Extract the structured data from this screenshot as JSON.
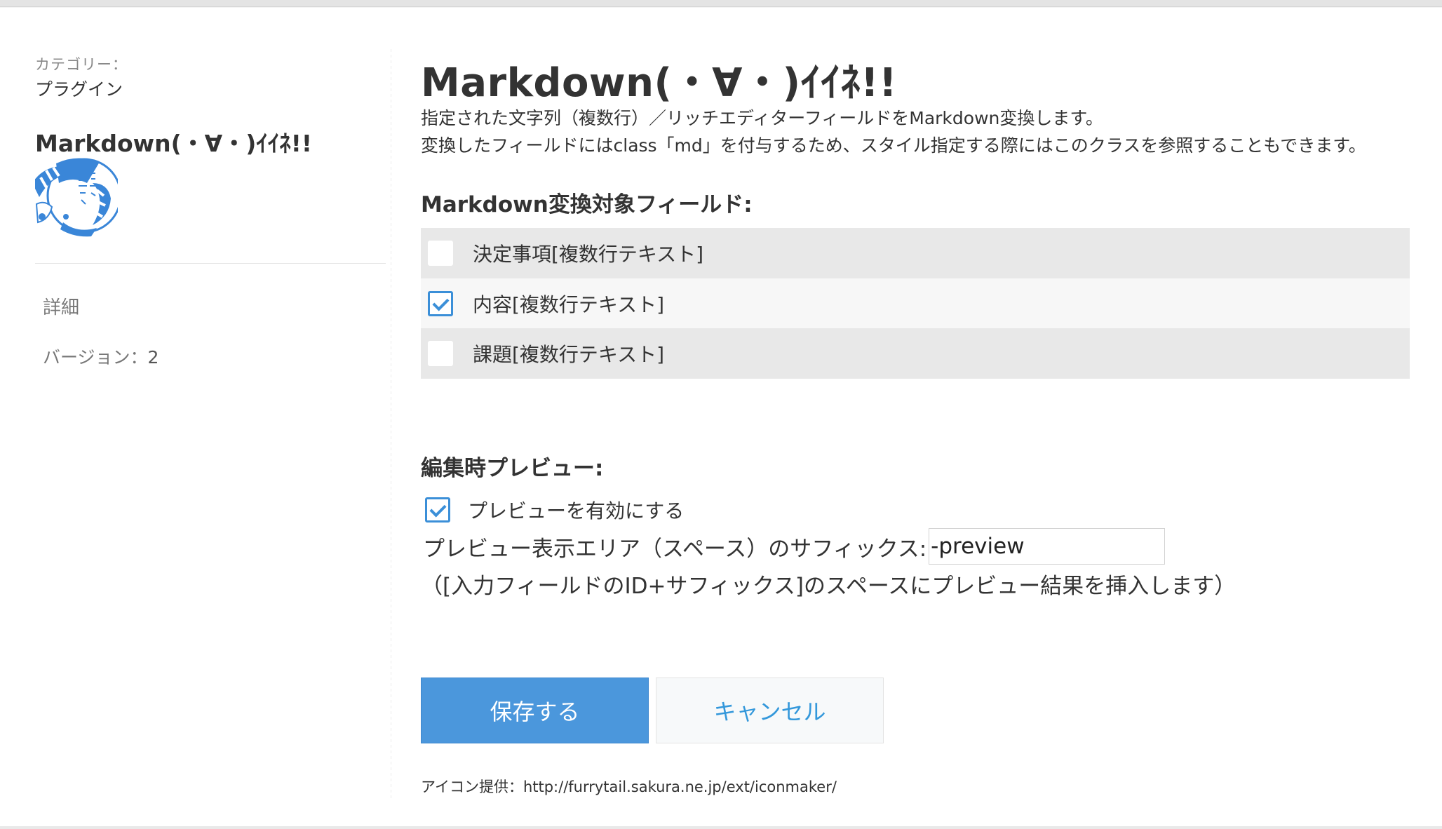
{
  "sidebar": {
    "category_label": "カテゴリー：",
    "category_value": "プラグイン",
    "plugin_name": "Markdown(・∀・)ｲｲﾈ!!",
    "icon": "markdown-character-icon",
    "detail_label": "詳細",
    "version_label": "バージョン：",
    "version_value": "2"
  },
  "main": {
    "title": "Markdown(・∀・)ｲｲﾈ!!",
    "description_lines": [
      "指定された文字列（複数行）／リッチエディターフィールドをMarkdown変換します。",
      "変換したフィールドにはclass「md」を付与するため、スタイル指定する際にはこのクラスを参照することもできます。"
    ],
    "fields_heading": "Markdown変換対象フィールド:",
    "fields": [
      {
        "label": "決定事項[複数行テキスト]",
        "checked": false
      },
      {
        "label": "内容[複数行テキスト]",
        "checked": true
      },
      {
        "label": "課題[複数行テキスト]",
        "checked": false
      }
    ],
    "preview_heading": "編集時プレビュー:",
    "preview_enable_label": "プレビューを有効にする",
    "preview_enabled": true,
    "suffix_label": "プレビュー表示エリア（スペース）のサフィックス:",
    "suffix_value": "-preview",
    "suffix_note": "（[入力フィールドのID+サフィックス]のスペースにプレビュー結果を挿入します）",
    "save_label": "保存する",
    "cancel_label": "キャンセル",
    "credit": "アイコン提供：http://furrytail.sakura.ne.jp/ext/iconmaker/"
  },
  "colors": {
    "accent": "#4b97dc",
    "checkbox_border": "#3b8fd8",
    "cancel_text": "#3498db",
    "row_odd": "#e8e8e8",
    "row_even": "#f7f7f7"
  }
}
